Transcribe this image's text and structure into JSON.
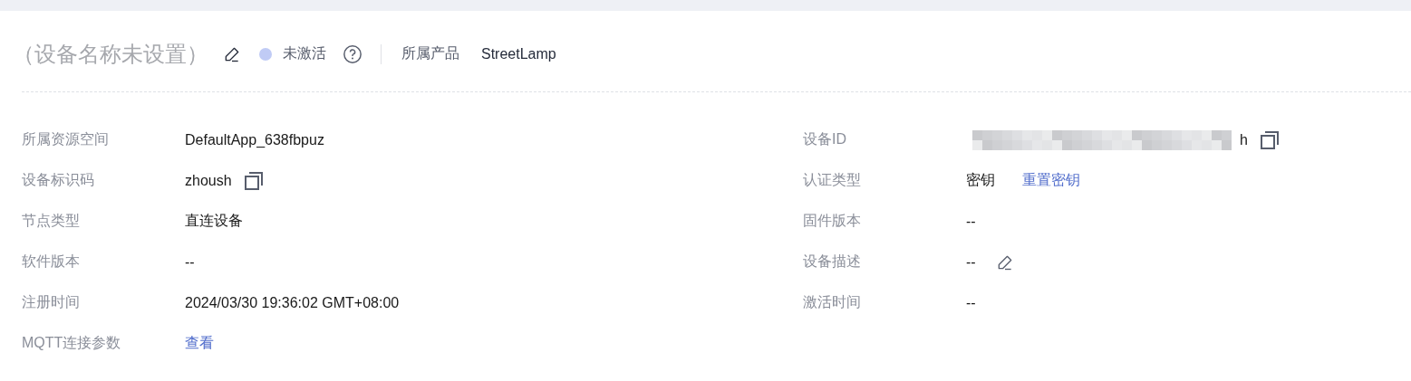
{
  "header": {
    "title": "（设备名称未设置）",
    "editable": true,
    "status": {
      "label": "未激活",
      "color": "#c0cbf5"
    },
    "help": true,
    "product_label": "所属产品",
    "product": "StreetLamp"
  },
  "rows": [
    {
      "left": {
        "label": "所属资源空间",
        "value": "DefaultApp_638fbpuz"
      },
      "right": {
        "label": "设备ID",
        "value": "h",
        "redacted": true,
        "copyable": true
      }
    },
    {
      "left": {
        "label": "设备标识码",
        "value": "zhoush",
        "copyable": true
      },
      "right": {
        "label": "认证类型",
        "value": "密钥",
        "link": "重置密钥"
      }
    },
    {
      "left": {
        "label": "节点类型",
        "value": "直连设备"
      },
      "right": {
        "label": "固件版本",
        "value": "--"
      }
    },
    {
      "left": {
        "label": "软件版本",
        "value": "--"
      },
      "right": {
        "label": "设备描述",
        "value": "--",
        "editable": true
      }
    },
    {
      "left": {
        "label": "注册时间",
        "value": "2024/03/30 19:36:02 GMT+08:00"
      },
      "right": {
        "label": "激活时间",
        "value": "--"
      }
    },
    {
      "left": {
        "label": "MQTT连接参数",
        "link": "查看"
      }
    }
  ]
}
